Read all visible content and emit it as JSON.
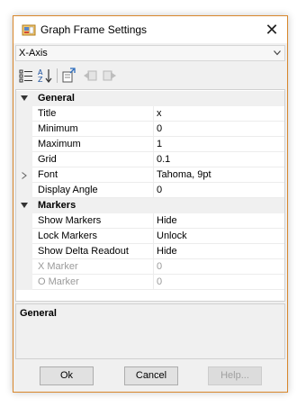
{
  "window": {
    "title": "Graph Frame Settings",
    "close_glyph": "✕"
  },
  "selector": {
    "selected": "X-Axis"
  },
  "toolbar": {
    "icons": [
      "categorized-icon",
      "alphabetical-icon",
      "property-pages-icon",
      "back-icon",
      "forward-icon"
    ]
  },
  "grid": {
    "categories": [
      {
        "label": "General",
        "properties": [
          {
            "name": "Title",
            "value": "x"
          },
          {
            "name": "Minimum",
            "value": "0"
          },
          {
            "name": "Maximum",
            "value": "1"
          },
          {
            "name": "Grid",
            "value": "0.1"
          },
          {
            "name": "Font",
            "value": "Tahoma, 9pt"
          },
          {
            "name": "Display Angle",
            "value": "0"
          }
        ]
      },
      {
        "label": "Markers",
        "properties": [
          {
            "name": "Show Markers",
            "value": "Hide"
          },
          {
            "name": "Lock Markers",
            "value": "Unlock"
          },
          {
            "name": "Show Delta Readout",
            "value": "Hide"
          },
          {
            "name": "X Marker",
            "value": "0"
          },
          {
            "name": "O Marker",
            "value": "0"
          }
        ]
      }
    ]
  },
  "description": {
    "title": "General"
  },
  "buttons": {
    "ok": "Ok",
    "cancel": "Cancel",
    "help": "Help..."
  },
  "colors": {
    "window_border": "#d8872c",
    "disabled_text": "#9a9a9a"
  }
}
